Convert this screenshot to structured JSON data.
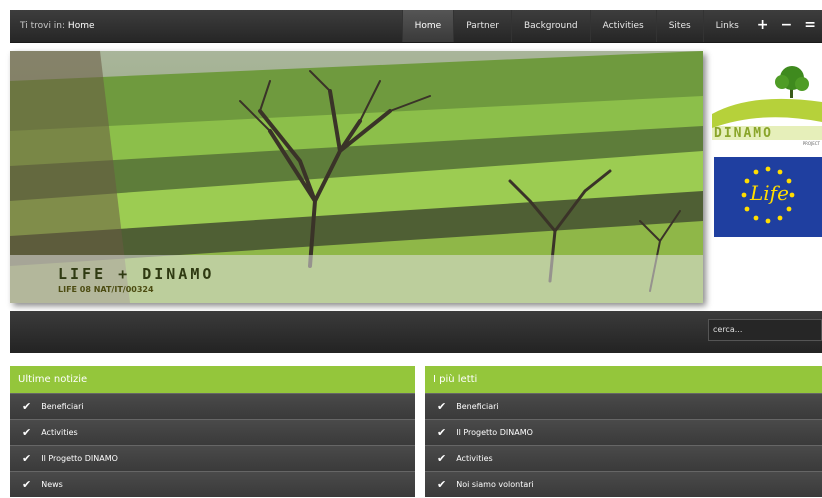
{
  "breadcrumb": {
    "prefix": "Ti trovi in:",
    "current": "Home"
  },
  "nav": {
    "items": [
      "Home",
      "Partner",
      "Background",
      "Activities",
      "Sites",
      "Links"
    ],
    "active": "Home",
    "zoom_in": "+",
    "zoom_out": "−",
    "more": "="
  },
  "hero": {
    "title": "LIFE + DINAMO",
    "subtitle": "LIFE 08 NAT/IT/00324"
  },
  "logos": {
    "dinamo_text": "DINAMO",
    "dinamo_tag": "PROJECT",
    "life_text": "Life"
  },
  "search": {
    "placeholder": "cerca..."
  },
  "panels": {
    "latest": {
      "title": "Ultime notizie",
      "items": [
        "Beneficiari",
        "Activities",
        "Il Progetto DINAMO",
        "News"
      ]
    },
    "popular": {
      "title": "I più letti",
      "items": [
        "Beneficiari",
        "Il Progetto DINAMO",
        "Activities",
        "Noi siamo volontari"
      ]
    }
  },
  "colors": {
    "accent": "#94c63b",
    "dark": "#2b2b2b",
    "eu_blue": "#1f3fa0"
  }
}
